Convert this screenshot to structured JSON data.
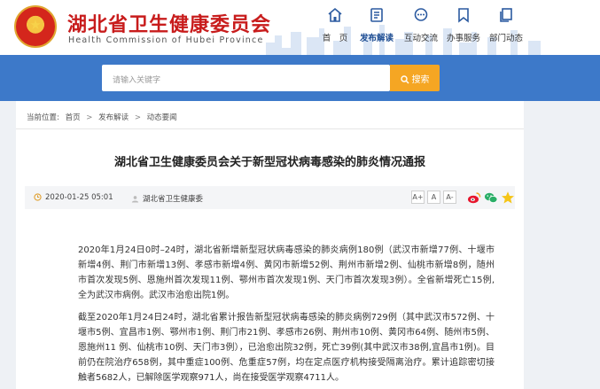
{
  "header": {
    "title": "湖北省卫生健康委员会",
    "subtitle": "Health Commission of Hubei Province",
    "nav": [
      {
        "label": "首　页",
        "icon": "home-icon"
      },
      {
        "label": "发布解读",
        "icon": "document-icon"
      },
      {
        "label": "互动交流",
        "icon": "chat-icon"
      },
      {
        "label": "办事服务",
        "icon": "bookmark-icon"
      },
      {
        "label": "部门动态",
        "icon": "pages-icon"
      }
    ]
  },
  "search": {
    "placeholder": "请输入关键字",
    "button_label": "搜索"
  },
  "breadcrumb": {
    "prefix": "当前位置:",
    "items": [
      "首页",
      "发布解读",
      "动态要闻"
    ],
    "sep": ">"
  },
  "article": {
    "title": "湖北省卫生健康委员会关于新型冠状病毒感染的肺炎情况通报",
    "date": "2020-01-25 05:01",
    "source": "湖北省卫生健康委",
    "font_controls": [
      "A+",
      "A",
      "A-"
    ],
    "share_icons": [
      "weibo-icon",
      "wechat-icon",
      "favorite-star-icon"
    ],
    "paragraphs": [
      "2020年1月24日0时–24时，湖北省新增新型冠状病毒感染的肺炎病例180例（武汉市新增77例、十堰市新增4例、荆门市新增13例、孝感市新增4例、黄冈市新增52例、荆州市新增2例、仙桃市新增8例，随州市首次发现5例、恩施州首次发现11例、鄂州市首次发现1例、天门市首次发现3例）。全省新增死亡15例,全为武汉市病例。武汉市治愈出院1例。",
      "截至2020年1月24日24时，湖北省累计报告新型冠状病毒感染的肺炎病例729例（其中武汉市572例、十堰市5例、宜昌市1例、鄂州市1例、荆门市21例、孝感市26例、荆州市10例、黄冈市64例、随州市5例、恩施州11 例、仙桃市10例、天门市3例），已治愈出院32例，死亡39例(其中武汉市38例,宜昌市1例)。目前仍在院治疗658例，其中重症100例、危重症57例，均在定点医疗机构接受隔离治疗。累计追踪密切接触者5682人，已解除医学观察971人，尚在接受医学观察4711人。"
    ]
  },
  "colors": {
    "brand_red": "#c81c1c",
    "nav_blue": "#1f4e93",
    "banner_blue": "#3d79c9",
    "search_orange": "#f5a623"
  }
}
